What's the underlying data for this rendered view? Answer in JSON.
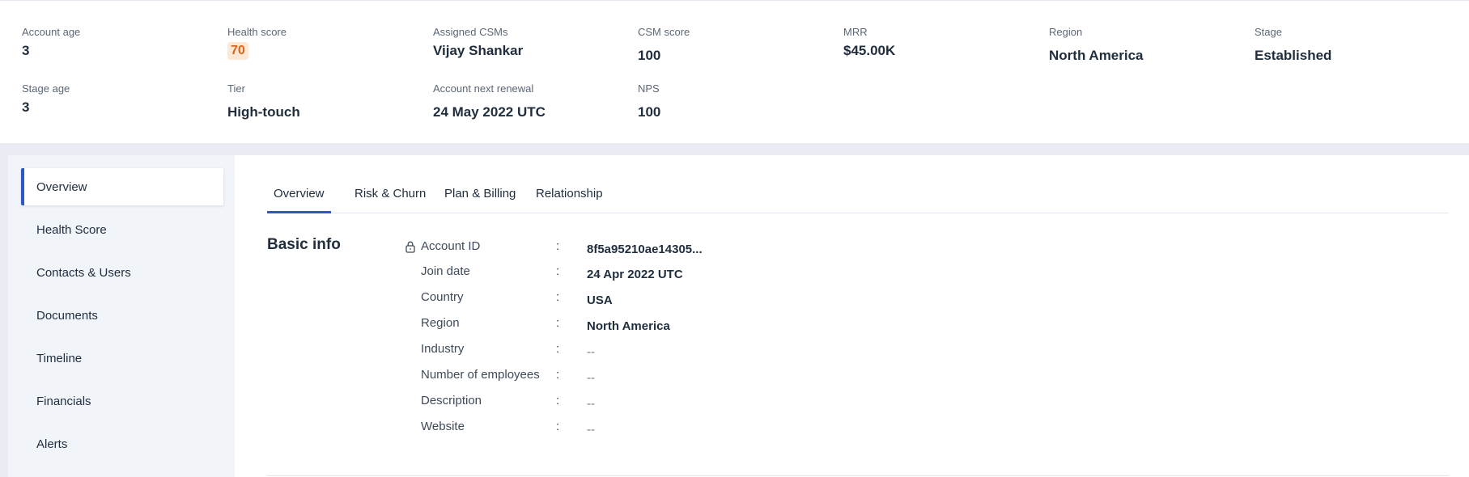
{
  "summary": {
    "account_age": {
      "label": "Account age",
      "value": "3"
    },
    "health_score": {
      "label": "Health score",
      "value": "70"
    },
    "assigned_csms": {
      "label": "Assigned CSMs",
      "value": "Vijay Shankar"
    },
    "csm_score": {
      "label": "CSM score",
      "value": "100"
    },
    "mrr": {
      "label": "MRR",
      "value": "$45.00K"
    },
    "region": {
      "label": "Region",
      "value": "North America"
    },
    "stage": {
      "label": "Stage",
      "value": "Established"
    },
    "stage_age": {
      "label": "Stage age",
      "value": "3"
    },
    "tier": {
      "label": "Tier",
      "value": "High-touch"
    },
    "next_renewal": {
      "label": "Account next renewal",
      "value": "24 May 2022 UTC"
    },
    "nps": {
      "label": "NPS",
      "value": "100"
    }
  },
  "sidebar": {
    "items": [
      {
        "label": "Overview",
        "active": true
      },
      {
        "label": "Health Score"
      },
      {
        "label": "Contacts & Users"
      },
      {
        "label": "Documents"
      },
      {
        "label": "Timeline"
      },
      {
        "label": "Financials"
      },
      {
        "label": "Alerts"
      }
    ]
  },
  "tabs": [
    {
      "label": "Overview",
      "active": true
    },
    {
      "label": "Risk & Churn"
    },
    {
      "label": "Plan & Billing"
    },
    {
      "label": "Relationship"
    }
  ],
  "basic_info": {
    "title": "Basic info",
    "colon": ":",
    "rows": [
      {
        "label": "Account ID",
        "value": "8f5a95210ae14305...",
        "icon": "lock-icon"
      },
      {
        "label": "Join date",
        "value": "24 Apr 2022 UTC"
      },
      {
        "label": "Country",
        "value": "USA"
      },
      {
        "label": "Region",
        "value": "North America"
      },
      {
        "label": "Industry",
        "value": "--"
      },
      {
        "label": "Number of employees",
        "value": "--"
      },
      {
        "label": "Description",
        "value": "--"
      },
      {
        "label": "Website",
        "value": "--"
      }
    ]
  },
  "colors": {
    "accent": "#2d56c6",
    "health_badge_bg": "#fde8d6",
    "health_badge_text": "#d8661c"
  }
}
